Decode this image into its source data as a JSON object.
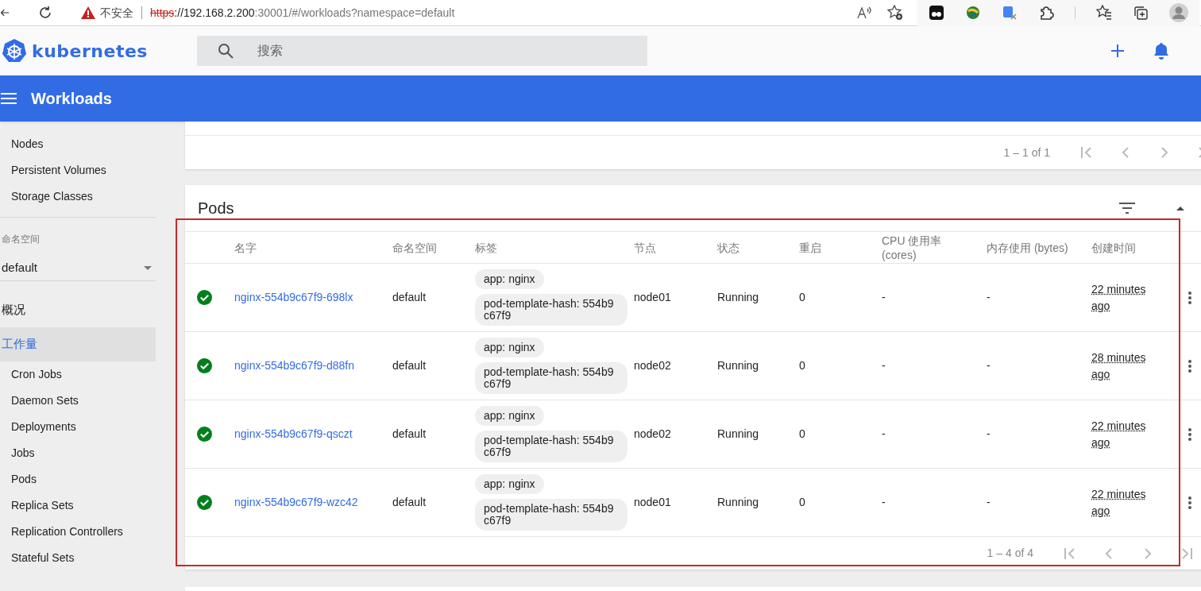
{
  "browser": {
    "security_label": "不安全",
    "url": {
      "scheme": "https",
      "host": "://192.168.2.200",
      "path": ":30001/#/workloads?namespace=default"
    }
  },
  "app": {
    "logo_text": "kubernetes",
    "search_placeholder": "搜索"
  },
  "toolbar": {
    "title": "Workloads"
  },
  "sidebar": {
    "cluster_items": [
      {
        "label": "Nodes",
        "selected": false
      },
      {
        "label": "Persistent Volumes",
        "selected": false
      },
      {
        "label": "Storage Classes",
        "selected": false
      }
    ],
    "namespace": {
      "label": "命名空间",
      "value": "default"
    },
    "nav": [
      {
        "label": "概况",
        "selected": false
      },
      {
        "label": "工作量",
        "selected": true,
        "children": [
          {
            "label": "Cron Jobs",
            "selected": false
          },
          {
            "label": "Daemon Sets",
            "selected": false
          },
          {
            "label": "Deployments",
            "selected": false
          },
          {
            "label": "Jobs",
            "selected": false
          },
          {
            "label": "Pods",
            "selected": false
          },
          {
            "label": "Replica Sets",
            "selected": false
          },
          {
            "label": "Replication Controllers",
            "selected": false
          },
          {
            "label": "Stateful Sets",
            "selected": false
          }
        ]
      }
    ]
  },
  "deployments_card": {
    "pagination": "1 – 1 of 1"
  },
  "pods": {
    "title": "Pods",
    "columns": [
      "名字",
      "命名空间",
      "标签",
      "节点",
      "状态",
      "重启",
      "CPU 使用率 (cores)",
      "内存使用 (bytes)",
      "创建时间"
    ],
    "rows": [
      {
        "kind": "success",
        "name": "nginx-554b9c67f9-698lx",
        "namespace": "default",
        "labels": [
          "app: nginx",
          "pod-template-hash: 554b9c67f9"
        ],
        "node": "node01",
        "phase": "Running",
        "restarts": "0",
        "cpu": "-",
        "memory": "-",
        "created": "22 minutes ago"
      },
      {
        "kind": "success",
        "name": "nginx-554b9c67f9-d88fn",
        "namespace": "default",
        "labels": [
          "app: nginx",
          "pod-template-hash: 554b9c67f9"
        ],
        "node": "node02",
        "phase": "Running",
        "restarts": "0",
        "cpu": "-",
        "memory": "-",
        "created": "28 minutes ago"
      },
      {
        "kind": "success",
        "name": "nginx-554b9c67f9-qsczt",
        "namespace": "default",
        "labels": [
          "app: nginx",
          "pod-template-hash: 554b9c67f9"
        ],
        "node": "node02",
        "phase": "Running",
        "restarts": "0",
        "cpu": "-",
        "memory": "-",
        "created": "22 minutes ago"
      },
      {
        "kind": "success",
        "name": "nginx-554b9c67f9-wzc42",
        "namespace": "default",
        "labels": [
          "app: nginx",
          "pod-template-hash: 554b9c67f9"
        ],
        "node": "node01",
        "phase": "Running",
        "restarts": "0",
        "cpu": "-",
        "memory": "-",
        "created": "22 minutes ago"
      }
    ],
    "pagination": "1 – 4 of 4"
  }
}
